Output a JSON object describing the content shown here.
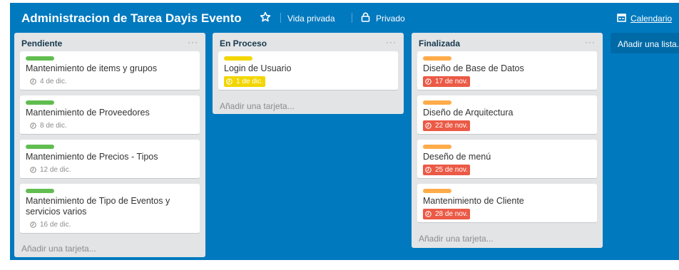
{
  "board": {
    "title": "Administracion de Tarea Dayis Evento",
    "visibility": "Vida privada",
    "privacy": "Privado",
    "calendar": "Calendario",
    "background_color": "#0079bf"
  },
  "lists": [
    {
      "name": "Pendiente",
      "menu": "···",
      "add_card": "Añadir una tarjeta...",
      "cards": [
        {
          "title": "Mantenimiento de items y grupos",
          "due": "4 de dic.",
          "label_color": "#61bd4f"
        },
        {
          "title": "Mantenimiento de Proveedores",
          "due": "8 de dic.",
          "label_color": "#61bd4f"
        },
        {
          "title": "Mantenimiento de Precios - Tipos",
          "due": "12 de dic.",
          "label_color": "#61bd4f"
        },
        {
          "title": "Mantenimiento de Tipo de Eventos y servicios varios",
          "due": "16 de dic.",
          "label_color": "#61bd4f"
        }
      ]
    },
    {
      "name": "En Proceso",
      "menu": "···",
      "add_card": "Añadir una tarjeta...",
      "cards": [
        {
          "title": "Login de Usuario",
          "due": "1 de dic.",
          "label_color": "#f2d600",
          "due_color": "#f2d600"
        }
      ]
    },
    {
      "name": "Finalizada",
      "menu": "···",
      "add_card": "Añadir una tarjeta...",
      "cards": [
        {
          "title": "Diseño de Base de Datos",
          "due": "17 de nov.",
          "label_color": "#ffab4a",
          "due_color": "#eb5a46"
        },
        {
          "title": "Diseño de Arquitectura",
          "due": "22 de nov.",
          "label_color": "#ffab4a",
          "due_color": "#eb5a46"
        },
        {
          "title": "Deseño de menú",
          "due": "25 de nov.",
          "label_color": "#ffab4a",
          "due_color": "#eb5a46"
        },
        {
          "title": "Mantenimiento de Cliente",
          "due": "28 de nov.",
          "label_color": "#ffab4a",
          "due_color": "#eb5a46"
        }
      ]
    }
  ],
  "add_list": "Añadir una lista..."
}
